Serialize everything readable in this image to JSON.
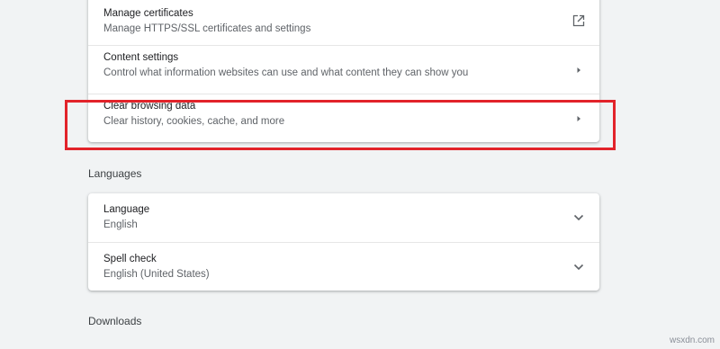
{
  "privacy_section": {
    "rows": [
      {
        "title": "Manage certificates",
        "subtitle": "Manage HTTPS/SSL certificates and settings",
        "icon": "open-in-new-icon"
      },
      {
        "title": "Content settings",
        "subtitle": "Control what information websites can use and what content they can show you",
        "icon": "chevron-right-icon"
      },
      {
        "title": "Clear browsing data",
        "subtitle": "Clear history, cookies, cache, and more",
        "icon": "chevron-right-icon"
      }
    ]
  },
  "languages_section": {
    "heading": "Languages",
    "rows": [
      {
        "title": "Language",
        "subtitle": "English",
        "icon": "chevron-down-icon"
      },
      {
        "title": "Spell check",
        "subtitle": "English (United States)",
        "icon": "chevron-down-icon"
      }
    ]
  },
  "downloads_section": {
    "heading": "Downloads"
  },
  "highlight_color": "#e2232a",
  "watermark": "wsxdn.com"
}
